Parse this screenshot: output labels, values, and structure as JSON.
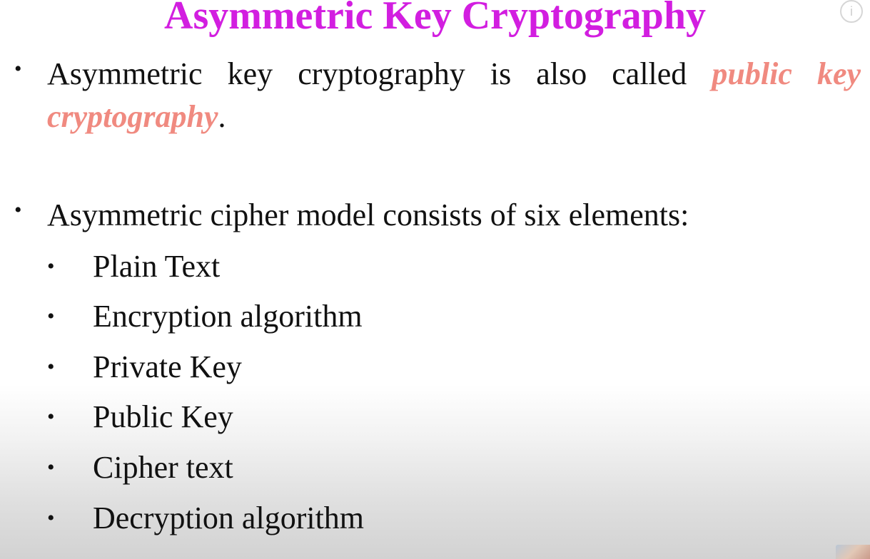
{
  "title": "Asymmetric Key Cryptography",
  "paragraph1": {
    "text": "Asymmetric key cryptography is also called",
    "emphasis": "public key cryptography",
    "end": "."
  },
  "paragraph2": {
    "text": "Asymmetric cipher model consists of six elements:"
  },
  "elements": [
    "Plain Text",
    "Encryption algorithm",
    "Private Key",
    "Public Key",
    "Cipher text",
    "Decryption algorithm"
  ],
  "info_icon": {
    "glyph": "i"
  },
  "colors": {
    "title": "#d21ee0",
    "emphasis": "#f08a80",
    "text": "#111111"
  },
  "icons": {
    "info": "info-icon"
  }
}
